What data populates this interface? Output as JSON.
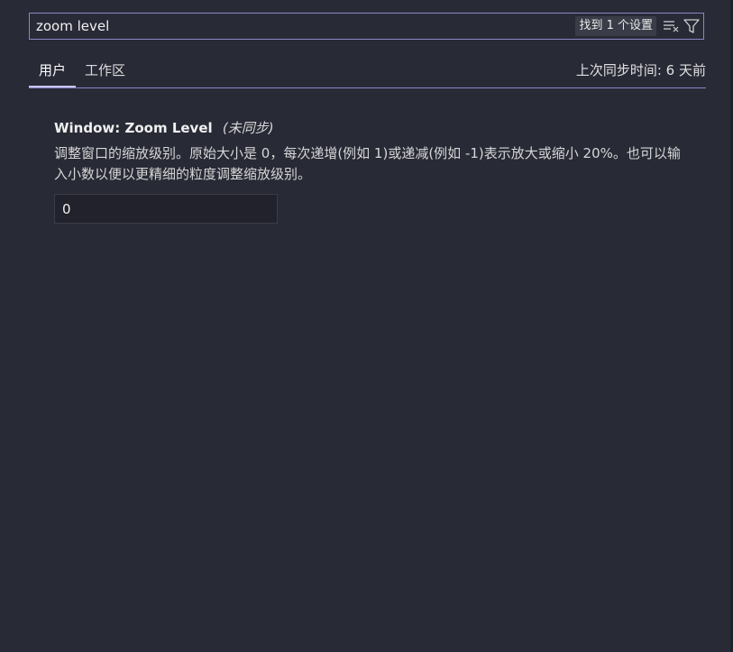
{
  "search": {
    "value": "zoom level",
    "result_label": "找到 1 个设置"
  },
  "icons": {
    "clear": "clear-filter-icon",
    "filter": "filter-icon"
  },
  "tabs": {
    "user": "用户",
    "workspace": "工作区"
  },
  "sync_status": "上次同步时间: 6 天前",
  "setting": {
    "title": "Window: Zoom Level",
    "note": "(未同步)",
    "description": "调整窗口的缩放级别。原始大小是 0，每次递增(例如 1)或递减(例如 -1)表示放大或缩小 20%。也可以输入小数以便以更精细的粒度调整缩放级别。",
    "value": "0"
  },
  "colors": {
    "background": "#282a36",
    "accent_border": "#8a86c8",
    "input_background": "#21222c"
  }
}
